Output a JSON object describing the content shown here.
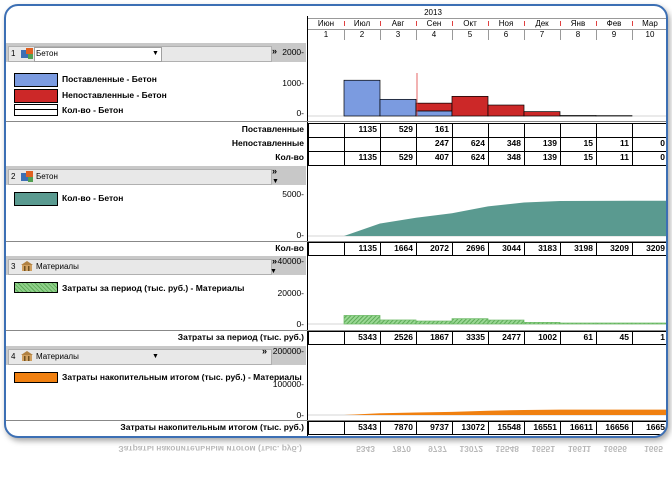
{
  "header": {
    "year": "2013",
    "months": [
      "Июн",
      "Июл",
      "Авг",
      "Сен",
      "Окт",
      "Ноя",
      "Дек",
      "Янв",
      "Фев",
      "Мар"
    ],
    "periods": [
      "1",
      "2",
      "3",
      "4",
      "5",
      "6",
      "7",
      "8",
      "9",
      "10"
    ]
  },
  "panel1": {
    "index": "1",
    "resource": "Бетон",
    "chevron": "»",
    "legend": [
      "Поставленные - Бетон",
      "Непоставленные - Бетон",
      "Кол-во - Бетон"
    ],
    "colors": {
      "delivered": "#7b9be0",
      "undelivered": "#cc2828",
      "qty": "#ffffff"
    },
    "yticks": [
      "2000-",
      "1000-",
      "0-"
    ],
    "chart_data": {
      "type": "bar",
      "categories": [
        "Июн",
        "Июл",
        "Авг",
        "Сен",
        "Окт",
        "Ноя",
        "Дек",
        "Янв",
        "Фев",
        "Мар"
      ],
      "series": [
        {
          "name": "Поставленные - Бетон",
          "values": [
            0,
            1135,
            529,
            161,
            0,
            0,
            0,
            0,
            0,
            0
          ]
        },
        {
          "name": "Непоставленные - Бетон",
          "values": [
            0,
            0,
            0,
            247,
            624,
            348,
            139,
            15,
            11,
            0
          ]
        }
      ],
      "ylim": [
        0,
        2000
      ]
    },
    "rows": [
      {
        "label": "Поставленные",
        "values": [
          "",
          "1135",
          "529",
          "161",
          "",
          "",
          "",
          "",
          "",
          ""
        ]
      },
      {
        "label": "Непоставленные",
        "values": [
          "",
          "",
          "",
          "247",
          "624",
          "348",
          "139",
          "15",
          "11",
          "0"
        ]
      },
      {
        "label": "Кол-во",
        "values": [
          "",
          "1135",
          "529",
          "407",
          "624",
          "348",
          "139",
          "15",
          "11",
          "0"
        ]
      }
    ]
  },
  "panel2": {
    "index": "2",
    "resource": "Бетон",
    "chevron": "»",
    "legend": [
      "Кол-во - Бетон"
    ],
    "colors": {
      "fill": "#5a9a90"
    },
    "yticks": [
      "5000-",
      "0-"
    ],
    "chart_data": {
      "type": "area",
      "categories": [
        "Июн",
        "Июл",
        "Авг",
        "Сен",
        "Окт",
        "Ноя",
        "Дек",
        "Янв",
        "Фев",
        "Мар"
      ],
      "series": [
        {
          "name": "Кол-во - Бетон",
          "values": [
            0,
            1135,
            1664,
            2072,
            2696,
            3044,
            3183,
            3198,
            3209,
            3209
          ]
        }
      ],
      "ylim": [
        0,
        6000
      ]
    },
    "rows": [
      {
        "label": "Кол-во",
        "values": [
          "",
          "1135",
          "1664",
          "2072",
          "2696",
          "3044",
          "3183",
          "3198",
          "3209",
          "3209"
        ]
      }
    ]
  },
  "panel3": {
    "index": "3",
    "resource": "Материалы",
    "chevron": "»",
    "legend": [
      "Затраты за период (тыс. руб.) - Материалы"
    ],
    "colors": {
      "fill": "#8fcf8a"
    },
    "yticks": [
      "40000-",
      "20000-",
      "0-"
    ],
    "chart_data": {
      "type": "bar",
      "categories": [
        "Июн",
        "Июл",
        "Авг",
        "Сен",
        "Окт",
        "Ноя",
        "Дек",
        "Янв",
        "Фев",
        "Мар"
      ],
      "series": [
        {
          "name": "Затраты за период (тыс. руб.) - Материалы",
          "values": [
            0,
            5343,
            2526,
            1867,
            3335,
            2477,
            1002,
            61,
            45,
            1
          ]
        }
      ],
      "ylim": [
        0,
        40000
      ]
    },
    "rows": [
      {
        "label": "Затраты за период (тыс. руб.)",
        "values": [
          "",
          "5343",
          "2526",
          "1867",
          "3335",
          "2477",
          "1002",
          "61",
          "45",
          "1"
        ]
      }
    ]
  },
  "panel4": {
    "index": "4",
    "resource": "Материалы",
    "chevron": "»",
    "legend": [
      "Затраты накопительным итогом (тыс. руб.) - Материалы"
    ],
    "colors": {
      "fill": "#f08010"
    },
    "yticks": [
      "200000-",
      "100000-",
      "0-"
    ],
    "chart_data": {
      "type": "area",
      "categories": [
        "Июн",
        "Июл",
        "Авг",
        "Сен",
        "Окт",
        "Ноя",
        "Дек",
        "Янв",
        "Фев",
        "Мар"
      ],
      "series": [
        {
          "name": "Затраты накопительным итогом (тыс. руб.) - Материалы",
          "values": [
            0,
            5343,
            7870,
            9737,
            13072,
            15548,
            16551,
            16611,
            16656,
            16657
          ]
        }
      ],
      "ylim": [
        0,
        200000
      ]
    },
    "rows": [
      {
        "label": "Затраты накопительным итогом (тыс. руб.)",
        "values": [
          "",
          "5343",
          "7870",
          "9737",
          "13072",
          "15548",
          "16551",
          "16611",
          "16656",
          "1665"
        ]
      }
    ]
  }
}
